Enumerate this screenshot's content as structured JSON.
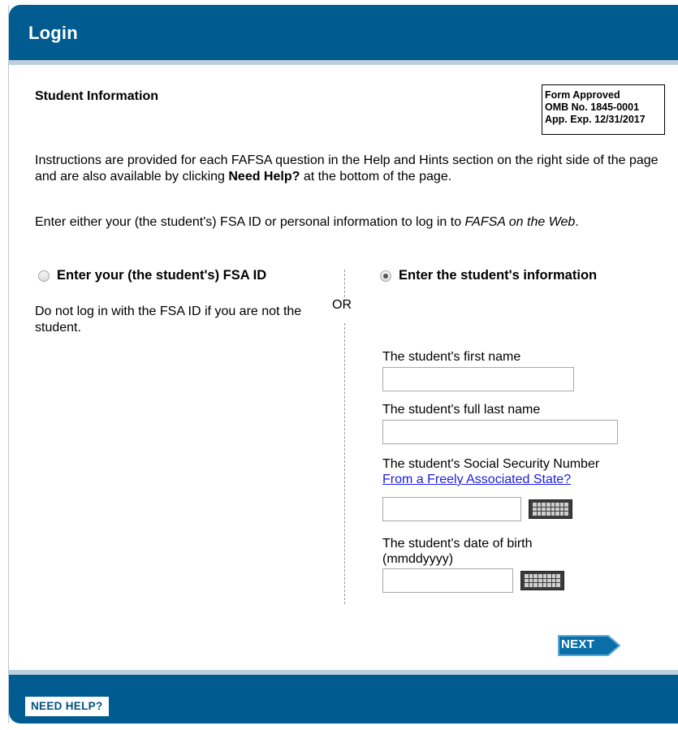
{
  "header": {
    "title": "Login"
  },
  "section": {
    "title": "Student Information",
    "omb": {
      "line1": "Form Approved",
      "line2": "OMB No. 1845-0001",
      "line3": "App. Exp. 12/31/2017"
    }
  },
  "instructions": {
    "para1_before": "Instructions are provided for each FAFSA question in the Help and Hints section on the right side of the page and are also available by clicking ",
    "para1_bold": "Need Help?",
    "para1_after": " at the bottom of the page.",
    "para2_before": "Enter either your (the student's) FSA ID or personal information to log in to ",
    "para2_italic": "FAFSA on the Web",
    "para2_after": "."
  },
  "options": {
    "fsa_id_label": "Enter your (the student's) FSA ID",
    "fsa_id_selected": false,
    "fsa_id_note": "Do not log in with the FSA ID if you are not the student.",
    "or_text": "OR",
    "student_info_label": "Enter the student's information",
    "student_info_selected": true
  },
  "form": {
    "first_name_label": "The student's first name",
    "first_name_value": "",
    "last_name_label": "The student's full last name",
    "last_name_value": "",
    "ssn_label": "The student's Social Security Number",
    "ssn_link": "From a Freely Associated State?",
    "ssn_value": "",
    "dob_label_line1": "The student's date of birth",
    "dob_label_line2": "(mmddyyyy)",
    "dob_value": "",
    "keyboard_icon": "keyboard-icon"
  },
  "actions": {
    "next_label": "NEXT",
    "help_label": "NEED HELP?"
  },
  "colors": {
    "header_blue": "#005b90",
    "strip": "#bcd0dc",
    "next_blue": "#0a6fa8"
  }
}
